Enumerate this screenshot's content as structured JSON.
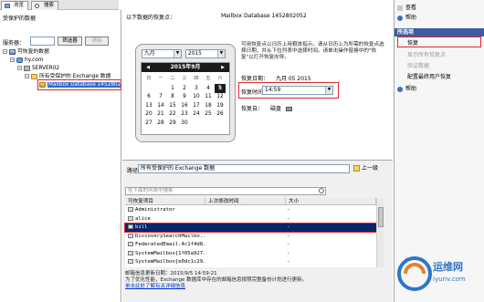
{
  "tabs": [
    {
      "label": "浏览"
    },
    {
      "label": "搜索"
    }
  ],
  "left": {
    "title": "受保护的数据",
    "server_label": "服务器：",
    "server_value": "",
    "find_button": "筛选器",
    "clear_button": "清除",
    "tree": [
      {
        "label": "可恢复的数据"
      },
      {
        "label": "hy.com"
      },
      {
        "label": "SERVER02"
      },
      {
        "label": "所有受保护的 Exchange 数据"
      },
      {
        "label": "Mailbox Database 1452802"
      }
    ]
  },
  "middle": {
    "header_left": "以下数据的恢复点：",
    "header_right": "Mailbox Database 1452802052",
    "calendar": {
      "month_select": "九月",
      "year_select": "2015",
      "title": "2015年9月",
      "weekdays": [
        "日",
        "一",
        "二",
        "三",
        "四",
        "五",
        "六"
      ],
      "weeks": [
        [
          "",
          "",
          "1",
          "2",
          "3",
          "4",
          "5"
        ],
        [
          "6",
          "7",
          "8",
          "9",
          "10",
          "11",
          "12"
        ],
        [
          "13",
          "14",
          "15",
          "16",
          "17",
          "18",
          "19"
        ],
        [
          "20",
          "21",
          "22",
          "23",
          "24",
          "25",
          "26"
        ],
        [
          "27",
          "28",
          "29",
          "30",
          "",
          "",
          ""
        ]
      ],
      "selected_day": "5"
    },
    "info_text": "可用恢复点以日历上用粗体指示。请从日历上为所需的恢复点选择日期，并从下拉列表中选择时间。请单击操作窗格中的\"恢复\"以打开恢复向导。",
    "recovery_date_label": "恢复日期：",
    "recovery_date_value": "九月 05 2015",
    "recovery_time_label": "恢复时间：",
    "recovery_time_value": "14:59",
    "location_label": "恢复自：",
    "location_value": "磁盘"
  },
  "lower": {
    "path_label": "路径：",
    "path_value": "所有受保护的 Exchange 数据",
    "up_button": "上一级",
    "search_placeholder": "在下面的列表中搜索",
    "columns": [
      "可恢复项目",
      "上次修改时间",
      "大小"
    ],
    "rows": [
      {
        "name": "Administrator",
        "size": "-"
      },
      {
        "name": "alice",
        "size": "-"
      },
      {
        "name": "bill",
        "size": "-"
      },
      {
        "name": "DiscoverySearchMailbo...",
        "size": "-"
      },
      {
        "name": "FederatedEmail.4c1f4d8...",
        "size": "-"
      },
      {
        "name": "SystemMailbox{1f05a927...",
        "size": "-"
      },
      {
        "name": "SystemMailbox{e0dc1c29...",
        "size": "-"
      }
    ],
    "selected_row": 2,
    "status_line1": "邮箱信息更新日期：2015/9/5 14:59:21",
    "status_line2": "为了优化性能，Exchange 数据库中存在的邮箱信息按照完整备份计划进行更新。",
    "status_link": "单击此处了解有关详细信息"
  },
  "right": {
    "view_label": "查看",
    "help_label": "帮助",
    "section_title": "所选项",
    "items": [
      {
        "label": "恢复",
        "disabled": false
      },
      {
        "label": "显示所有恢复点",
        "disabled": true
      },
      {
        "label": "验证数据",
        "disabled": true
      },
      {
        "label": "配置最终用户恢复",
        "disabled": false
      }
    ],
    "help2_label": "帮助"
  },
  "watermark": {
    "text": "运维网",
    "sub": "iyunv.com"
  }
}
